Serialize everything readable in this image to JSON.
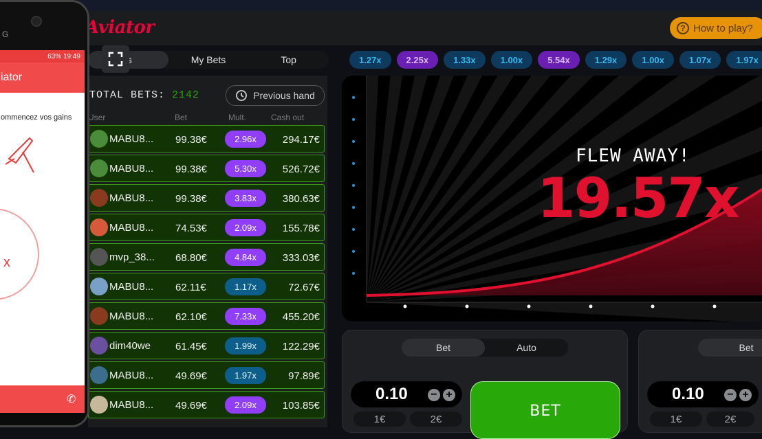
{
  "app": {
    "logo": "Aviator",
    "how_to_play": "How to play?"
  },
  "bets_tabs": [
    "ts",
    "My Bets",
    "Top"
  ],
  "total_bets_label": "TOTAL BETS:",
  "total_bets_value": "2142",
  "previous_hand": "Previous hand",
  "columns": {
    "user": "User",
    "bet": "Bet",
    "mult": "Mult.",
    "cashout": "Cash out"
  },
  "rows": [
    {
      "user": "MABU8...",
      "bet": "99.38€",
      "mult": "2.96x",
      "mult_color": "purple",
      "cashout": "294.17€"
    },
    {
      "user": "MABU8...",
      "bet": "99.38€",
      "mult": "5.30x",
      "mult_color": "purple",
      "cashout": "526.72€"
    },
    {
      "user": "MABU8...",
      "bet": "99.38€",
      "mult": "3.83x",
      "mult_color": "purple",
      "cashout": "380.63€"
    },
    {
      "user": "MABU8...",
      "bet": "74.53€",
      "mult": "2.09x",
      "mult_color": "purple",
      "cashout": "155.78€"
    },
    {
      "user": "mvp_38...",
      "bet": "68.80€",
      "mult": "4.84x",
      "mult_color": "purple",
      "cashout": "333.03€"
    },
    {
      "user": "MABU8...",
      "bet": "62.11€",
      "mult": "1.17x",
      "mult_color": "blue",
      "cashout": "72.67€"
    },
    {
      "user": "MABU8...",
      "bet": "62.10€",
      "mult": "7.33x",
      "mult_color": "purple",
      "cashout": "455.20€"
    },
    {
      "user": "dim40we",
      "bet": "61.45€",
      "mult": "1.99x",
      "mult_color": "blue",
      "cashout": "122.29€"
    },
    {
      "user": "MABU8...",
      "bet": "49.69€",
      "mult": "1.97x",
      "mult_color": "blue",
      "cashout": "97.89€"
    },
    {
      "user": "MABU8...",
      "bet": "49.69€",
      "mult": "2.09x",
      "mult_color": "purple",
      "cashout": "103.85€"
    }
  ],
  "history": [
    {
      "v": "1.27x",
      "c": "blue"
    },
    {
      "v": "2.25x",
      "c": "purple"
    },
    {
      "v": "1.33x",
      "c": "blue"
    },
    {
      "v": "1.00x",
      "c": "blue"
    },
    {
      "v": "5.54x",
      "c": "purple"
    },
    {
      "v": "1.29x",
      "c": "blue"
    },
    {
      "v": "1.00x",
      "c": "blue"
    },
    {
      "v": "1.07x",
      "c": "blue"
    },
    {
      "v": "1.97x",
      "c": "blue"
    }
  ],
  "game": {
    "status": "FLEW AWAY!",
    "multiplier": "19.57x"
  },
  "bet_panel_1": {
    "tabs": [
      "Bet",
      "Auto"
    ],
    "amount": "0.10",
    "quick": [
      "1€",
      "2€"
    ],
    "button": "BET"
  },
  "bet_panel_2": {
    "tabs": [
      "Bet"
    ],
    "amount": "0.10",
    "quick": [
      "1€",
      "2€"
    ]
  },
  "phone": {
    "brand": "G",
    "status": "63% 19:49",
    "app_title": "iator",
    "tagline": "ommencez vos gains",
    "x_text": "x"
  },
  "colors": {
    "accent_red": "#e50539",
    "green": "#28a909",
    "purple": "#913ef8",
    "blue": "#35b9f0",
    "orange": "#e69308"
  }
}
